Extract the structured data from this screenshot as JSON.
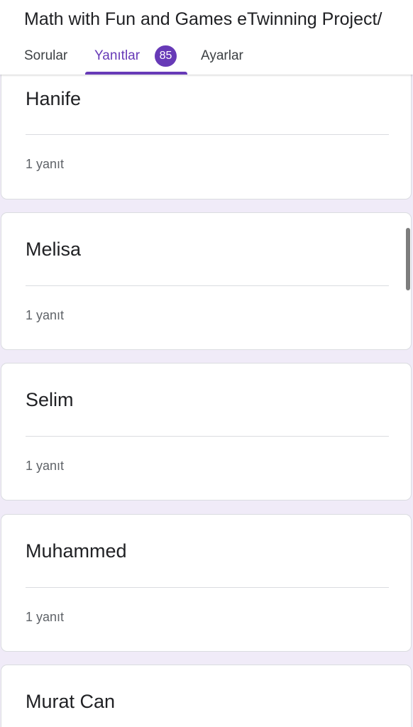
{
  "form": {
    "title": "Math with Fun and Games eTwinning Project/"
  },
  "tabs": {
    "questions": "Sorular",
    "responses": "Yanıtlar",
    "responses_count": "85",
    "settings": "Ayarlar"
  },
  "colors": {
    "accent": "#673ab7",
    "background": "#f0ebf8"
  },
  "cards": [
    {
      "title": "Hanife",
      "count": "1 yanıt"
    },
    {
      "title": "Melisa",
      "count": "1 yanıt"
    },
    {
      "title": "Selim",
      "count": "1 yanıt"
    },
    {
      "title": "Muhammed",
      "count": "1 yanıt"
    },
    {
      "title": "Murat Can"
    }
  ]
}
